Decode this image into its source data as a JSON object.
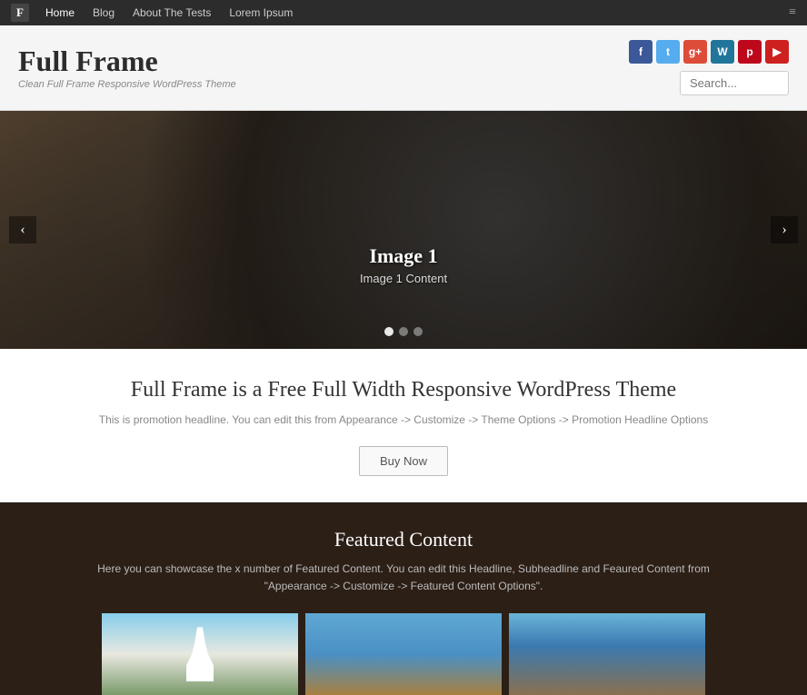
{
  "topnav": {
    "logo": "F",
    "links": [
      {
        "label": "Home",
        "active": true
      },
      {
        "label": "Blog",
        "active": false
      },
      {
        "label": "About The Tests",
        "active": false
      },
      {
        "label": "Lorem Ipsum",
        "active": false
      }
    ],
    "menu_icon": "≡"
  },
  "header": {
    "site_title": "Full Frame",
    "site_subtitle": "Clean Full Frame Responsive WordPress Theme",
    "social_icons": [
      {
        "name": "facebook",
        "label": "f"
      },
      {
        "name": "twitter",
        "label": "t"
      },
      {
        "name": "google-plus",
        "label": "g+"
      },
      {
        "name": "wordpress",
        "label": "W"
      },
      {
        "name": "pinterest",
        "label": "p"
      },
      {
        "name": "youtube",
        "label": "▶"
      }
    ],
    "search_placeholder": "Search..."
  },
  "hero": {
    "slide_title": "Image 1",
    "slide_subtitle": "Image 1 Content",
    "prev_arrow": "‹",
    "next_arrow": "›",
    "dots": [
      {
        "active": true
      },
      {
        "active": false
      },
      {
        "active": false
      }
    ]
  },
  "promo": {
    "title": "Full Frame is a Free Full Width Responsive WordPress Theme",
    "subtitle": "This is promotion headline. You can edit this from Appearance -> Customize -> Theme Options -> Promotion Headline Options",
    "buy_label": "Buy Now"
  },
  "featured": {
    "title": "Featured Content",
    "description": "Here you can showcase the x number of Featured Content. You can edit this Headline, Subheadline and Feaured Content from \"Appearance -> Customize -> Featured Content Options\".",
    "images": [
      {
        "alt": "featured-image-1"
      },
      {
        "alt": "featured-image-2"
      },
      {
        "alt": "featured-image-3"
      }
    ]
  }
}
